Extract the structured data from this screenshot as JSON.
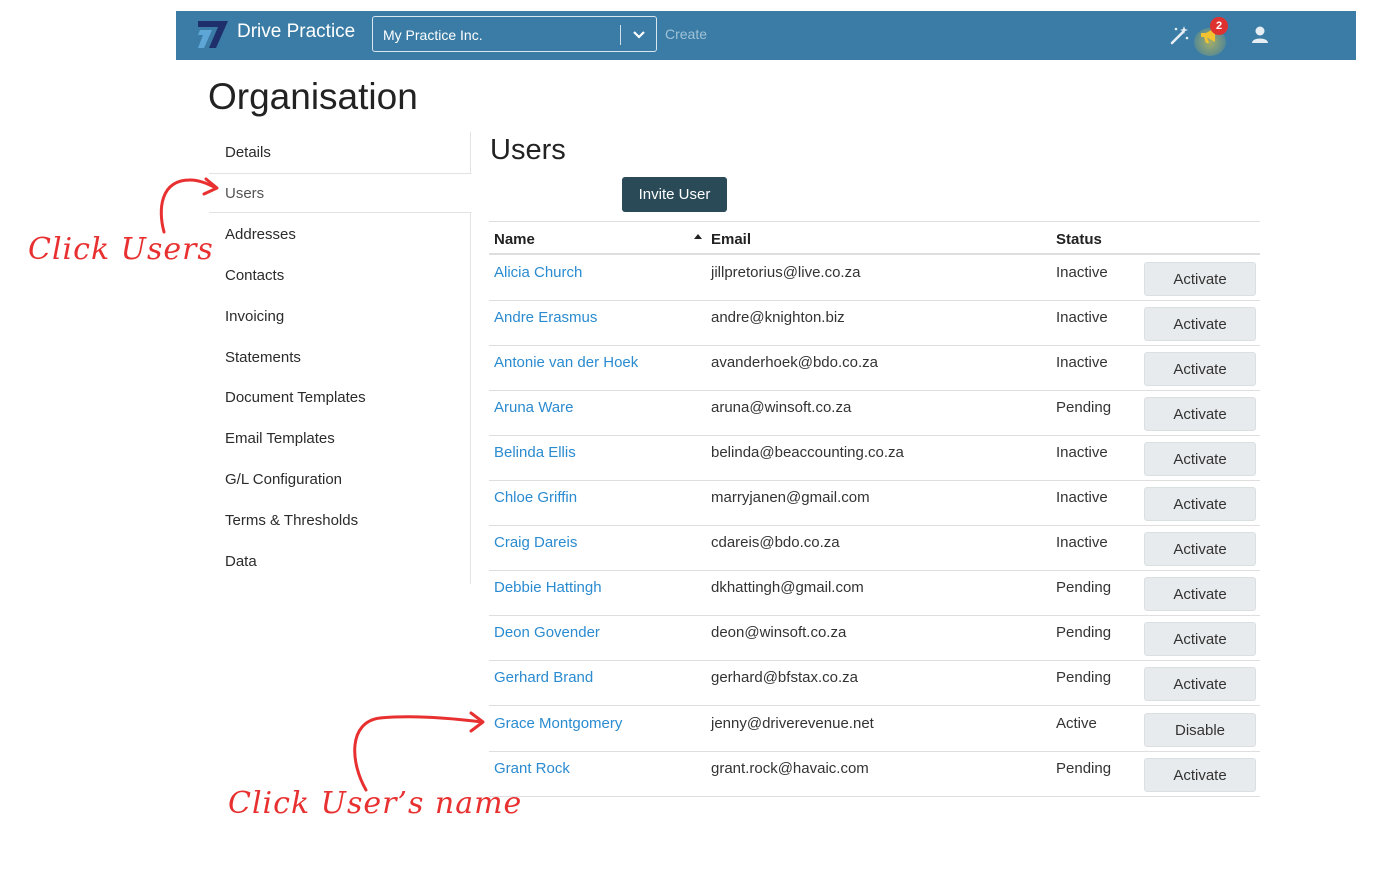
{
  "app": {
    "brand": "Drive Practice",
    "org_selector": "My Practice Inc.",
    "create_label": "Create",
    "notification_count": "2",
    "colors": {
      "topbar": "#3a7ca5",
      "link": "#2a8bd0",
      "primary_button": "#2a4a57",
      "annotation": "#e83030"
    },
    "icons": [
      "magic-wand-icon",
      "megaphone-icon",
      "user-icon",
      "chevron-down-icon",
      "sort-ascending-icon"
    ]
  },
  "page": {
    "title": "Organisation"
  },
  "sidebar": {
    "items": [
      {
        "label": "Details"
      },
      {
        "label": "Users",
        "active": true
      },
      {
        "label": "Addresses"
      },
      {
        "label": "Contacts"
      },
      {
        "label": "Invoicing"
      },
      {
        "label": "Statements"
      },
      {
        "label": "Document Templates"
      },
      {
        "label": "Email Templates"
      },
      {
        "label": "G/L Configuration"
      },
      {
        "label": "Terms & Thresholds"
      },
      {
        "label": "Data"
      }
    ]
  },
  "users": {
    "title": "Users",
    "invite_label": "Invite User",
    "columns": {
      "name": "Name",
      "email": "Email",
      "status": "Status"
    },
    "rows": [
      {
        "name": "Alicia Church",
        "email": "jillpretorius@live.co.za",
        "status": "Inactive",
        "action": "Activate"
      },
      {
        "name": "Andre Erasmus",
        "email": "andre@knighton.biz",
        "status": "Inactive",
        "action": "Activate"
      },
      {
        "name": "Antonie van der Hoek",
        "email": "avanderhoek@bdo.co.za",
        "status": "Inactive",
        "action": "Activate"
      },
      {
        "name": "Aruna Ware",
        "email": "aruna@winsoft.co.za",
        "status": "Pending",
        "action": "Activate"
      },
      {
        "name": "Belinda Ellis",
        "email": "belinda@beaccounting.co.za",
        "status": "Inactive",
        "action": "Activate"
      },
      {
        "name": "Chloe Griffin",
        "email": "marryjanen@gmail.com",
        "status": "Inactive",
        "action": "Activate"
      },
      {
        "name": "Craig Dareis",
        "email": "cdareis@bdo.co.za",
        "status": "Inactive",
        "action": "Activate"
      },
      {
        "name": "Debbie Hattingh",
        "email": "dkhattingh@gmail.com",
        "status": "Pending",
        "action": "Activate"
      },
      {
        "name": "Deon Govender",
        "email": "deon@winsoft.co.za",
        "status": "Pending",
        "action": "Activate"
      },
      {
        "name": "Gerhard Brand",
        "email": "gerhard@bfstax.co.za",
        "status": "Pending",
        "action": "Activate"
      },
      {
        "name": "Grace Montgomery",
        "email": "jenny@driverevenue.net",
        "status": "Active",
        "action": "Disable"
      },
      {
        "name": "Grant Rock",
        "email": "grant.rock@havaic.com",
        "status": "Pending",
        "action": "Activate"
      }
    ]
  },
  "annotations": {
    "click_users": "Click Users",
    "click_name": "Click User’s name"
  }
}
